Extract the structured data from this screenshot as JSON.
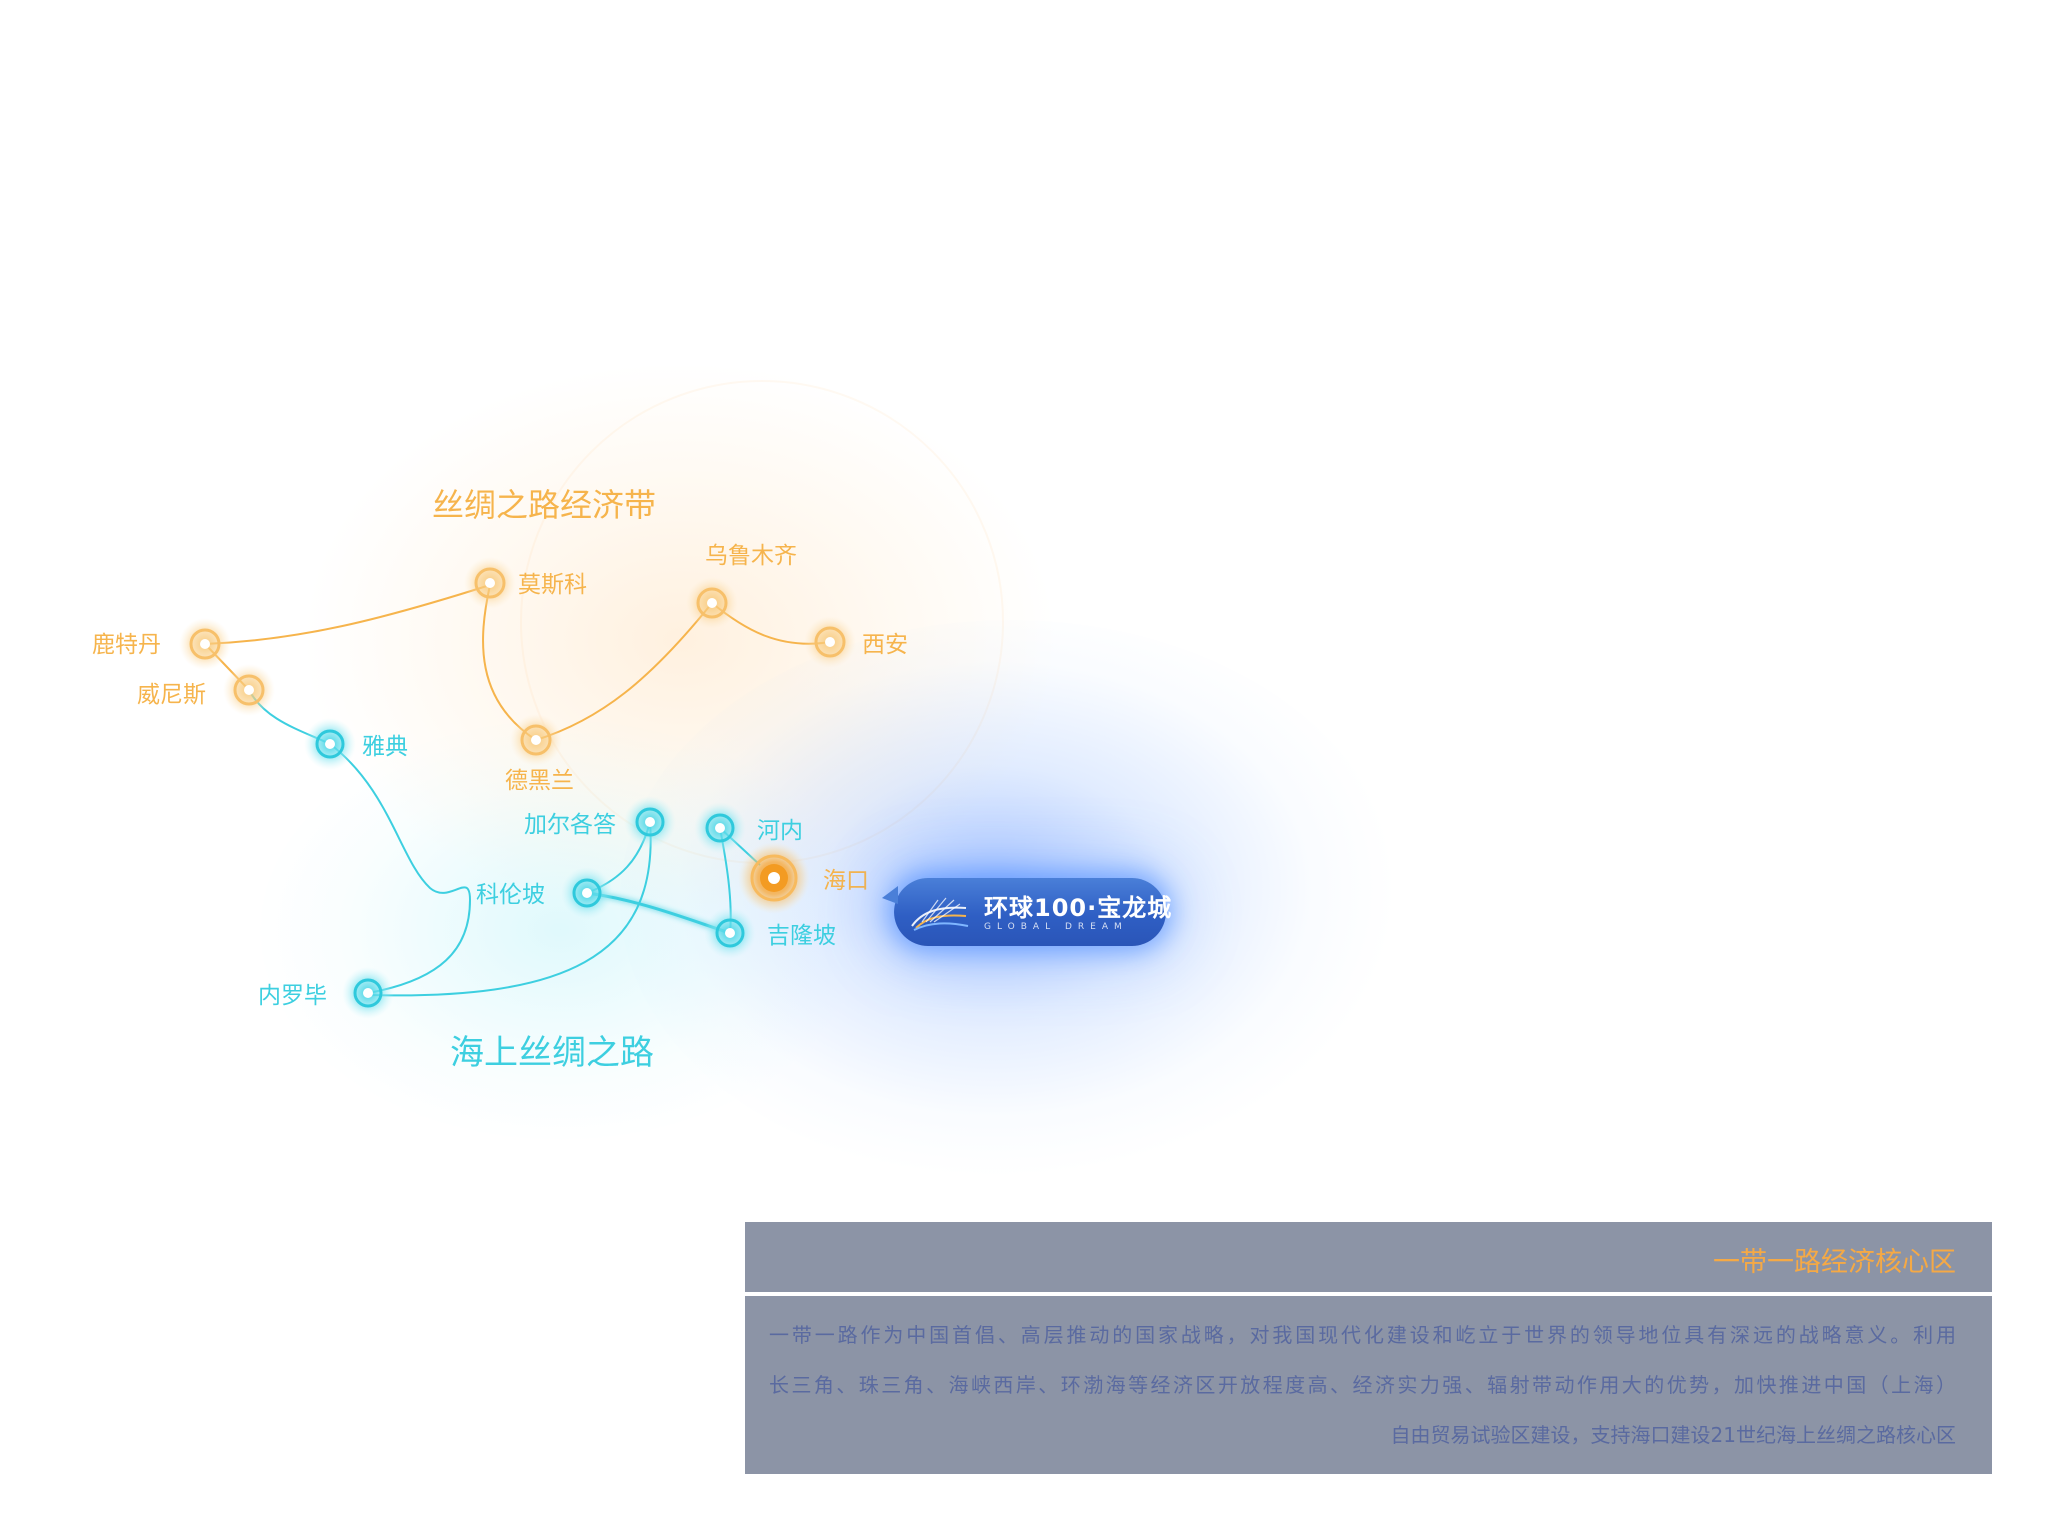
{
  "colors": {
    "orange": "#f6b44c",
    "cyan": "#3dcfe0",
    "accent_orange": "#f5a945",
    "panel_bg": "#8c94a6",
    "panel_text": "#5a6aa0",
    "bubble_blue": "#3566c8"
  },
  "diagram": {
    "silk_road_belt_title": "丝绸之路经济带",
    "maritime_silk_road_title": "海上丝绸之路",
    "belt_cities": [
      {
        "id": "rotterdam",
        "label": "鹿特丹"
      },
      {
        "id": "venice",
        "label": "威尼斯"
      },
      {
        "id": "moscow",
        "label": "莫斯科"
      },
      {
        "id": "tehran",
        "label": "德黑兰"
      },
      {
        "id": "urumqi",
        "label": "乌鲁木齐"
      },
      {
        "id": "xian",
        "label": "西安"
      }
    ],
    "maritime_cities": [
      {
        "id": "athens",
        "label": "雅典"
      },
      {
        "id": "kolkata",
        "label": "加尔各答"
      },
      {
        "id": "colombo",
        "label": "科伦坡"
      },
      {
        "id": "nairobi",
        "label": "内罗毕"
      },
      {
        "id": "hanoi",
        "label": "河内"
      },
      {
        "id": "kuala_lumpur",
        "label": "吉隆坡"
      }
    ],
    "hub": {
      "id": "haikou",
      "label": "海口"
    },
    "belt_route": [
      "rotterdam",
      "moscow",
      "tehran",
      "urumqi",
      "xian"
    ],
    "belt_branch": [
      "rotterdam",
      "venice"
    ],
    "maritime_route": [
      "venice",
      "athens",
      "nairobi",
      "kolkata",
      "colombo",
      "kuala_lumpur",
      "hanoi"
    ],
    "maritime_branch": [
      "nairobi",
      "colombo"
    ]
  },
  "brand_bubble": {
    "name": "环球100·宝龙城",
    "subtitle": "GLOBAL DREAM",
    "logo_icon": "wave-fan-logo"
  },
  "info_panel": {
    "title": "一带一路经济核心区",
    "lines": [
      "一带一路作为中国首倡、高层推动的国家战略，对我国现代化建设和屹立于世界的领导地位具有深远的战略意义。利用",
      "长三角、珠三角、海峡西岸、环渤海等经济区开放程度高、经济实力强、辐射带动作用大的优势，加快推进中国（上海）",
      "自由贸易试验区建设，支持海口建设21世纪海上丝绸之路核心区"
    ]
  }
}
